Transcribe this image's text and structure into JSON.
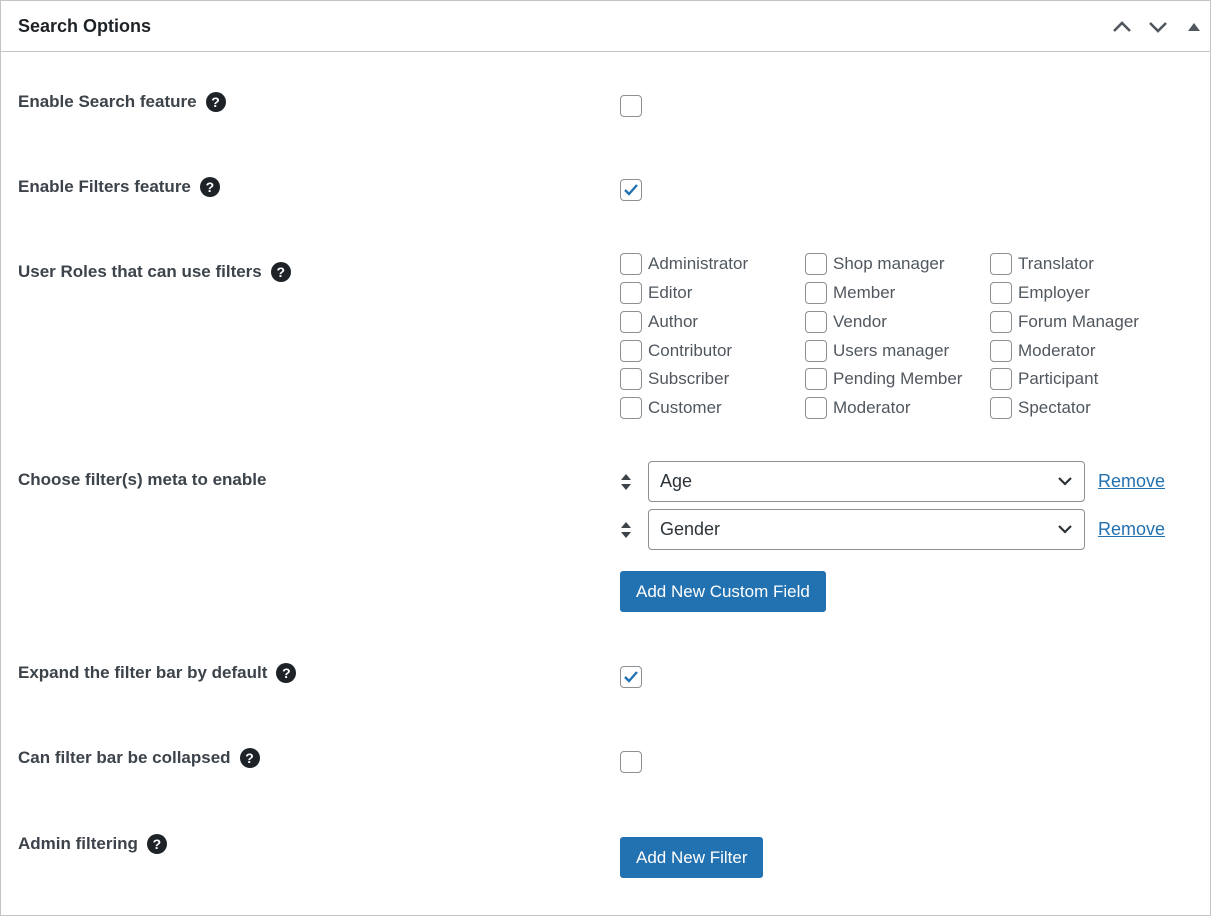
{
  "panel": {
    "title": "Search Options",
    "header_controls": [
      "move-up",
      "move-down",
      "toggle-panel"
    ]
  },
  "rows": {
    "enable_search": {
      "label": "Enable Search feature",
      "checked": false
    },
    "enable_filters": {
      "label": "Enable Filters feature",
      "checked": true
    },
    "user_roles": {
      "label": "User Roles that can use filters",
      "roles": [
        [
          "Administrator",
          "Editor",
          "Author",
          "Contributor",
          "Subscriber",
          "Customer"
        ],
        [
          "Shop manager",
          "Member",
          "Vendor",
          "Users manager",
          "Pending Member",
          "Moderator"
        ],
        [
          "Translator",
          "Employer",
          "Forum Manager",
          "Moderator",
          "Participant",
          "Spectator"
        ]
      ]
    },
    "filter_meta": {
      "label": "Choose filter(s) meta to enable",
      "fields": [
        {
          "value": "Age",
          "remove_label": "Remove"
        },
        {
          "value": "Gender",
          "remove_label": "Remove"
        }
      ],
      "add_button": "Add New Custom Field"
    },
    "expand_filter_bar": {
      "label": "Expand the filter bar by default",
      "checked": true
    },
    "collapse_filter_bar": {
      "label": "Can filter bar be collapsed",
      "checked": false
    },
    "admin_filtering": {
      "label": "Admin filtering",
      "add_button": "Add New Filter"
    }
  },
  "help_glyph": "?",
  "colors": {
    "accent": "#2271b1",
    "check": "#2271b1",
    "border": "#c3c4c7",
    "label": "#3c434a"
  }
}
